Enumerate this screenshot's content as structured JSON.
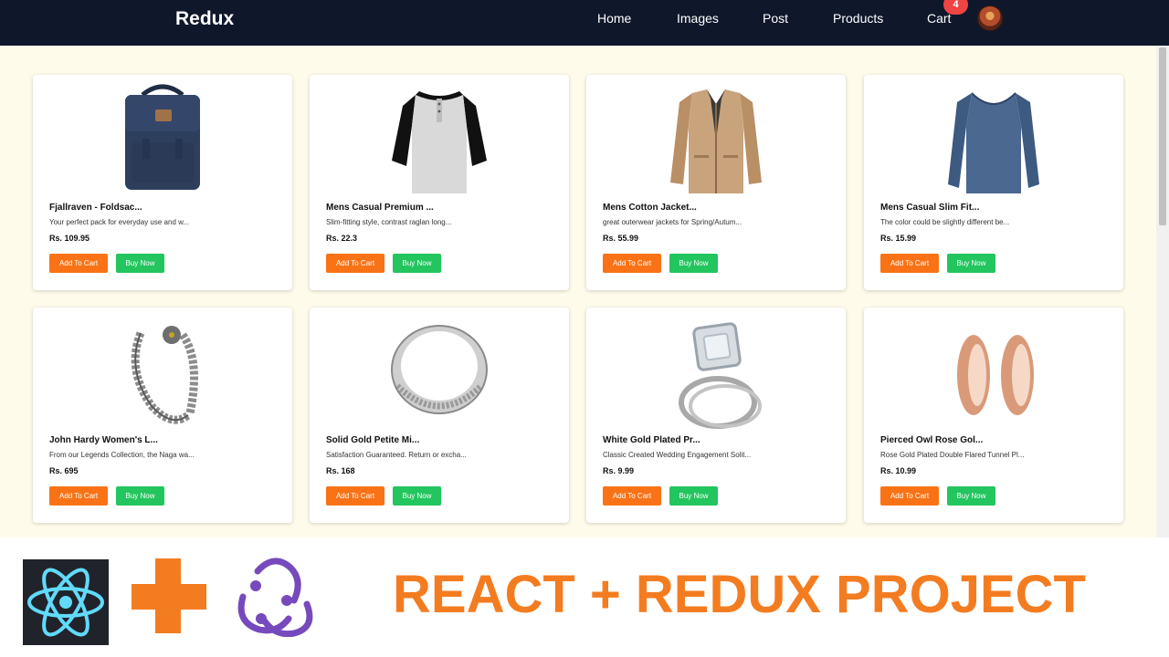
{
  "navbar": {
    "brand": "Redux",
    "links": [
      "Home",
      "Images",
      "Post",
      "Products",
      "Cart"
    ],
    "cart_count": "4",
    "background": "#0f172a"
  },
  "products": [
    {
      "title": "Fjallraven - Foldsac...",
      "desc": "Your perfect pack for everyday use and w...",
      "price": "Rs. 109.95",
      "icon": "backpack-image"
    },
    {
      "title": "Mens Casual Premium ...",
      "desc": "Slim-fitting style, contrast raglan long...",
      "price": "Rs. 22.3",
      "icon": "raglan-tshirt-image"
    },
    {
      "title": "Mens Cotton Jacket...",
      "desc": "great outerwear jackets for Spring/Autum...",
      "price": "Rs. 55.99",
      "icon": "cotton-jacket-image"
    },
    {
      "title": "Mens Casual Slim Fit...",
      "desc": "The color could be slightly different be...",
      "price": "Rs. 15.99",
      "icon": "slim-fit-shirt-image"
    },
    {
      "title": "John Hardy Women's L...",
      "desc": "From our Legends Collection, the Naga wa...",
      "price": "Rs. 695",
      "icon": "bracelet-image"
    },
    {
      "title": "Solid Gold Petite Mi...",
      "desc": "Satisfaction Guaranteed. Return or excha...",
      "price": "Rs. 168",
      "icon": "band-ring-image"
    },
    {
      "title": "White Gold Plated Pr...",
      "desc": "Classic Created Wedding Engagement Solit...",
      "price": "Rs. 9.99",
      "icon": "engagement-ring-image"
    },
    {
      "title": "Pierced Owl Rose Gol...",
      "desc": "Rose Gold Plated Double Flared Tunnel Pl...",
      "price": "Rs. 10.99",
      "icon": "tunnel-plugs-image"
    }
  ],
  "buttons": {
    "add_to_cart": "Add To Cart",
    "buy_now": "Buy Now"
  },
  "colors": {
    "add_to_cart": "#f97316",
    "buy_now": "#22c55e",
    "cart_badge": "#ef4444",
    "content_bg": "#fffbeb",
    "banner_text": "#f47c20"
  },
  "banner": {
    "title": "REACT + REDUX PROJECT",
    "icons": [
      "react-logo-icon",
      "plus-icon",
      "redux-logo-icon"
    ]
  }
}
